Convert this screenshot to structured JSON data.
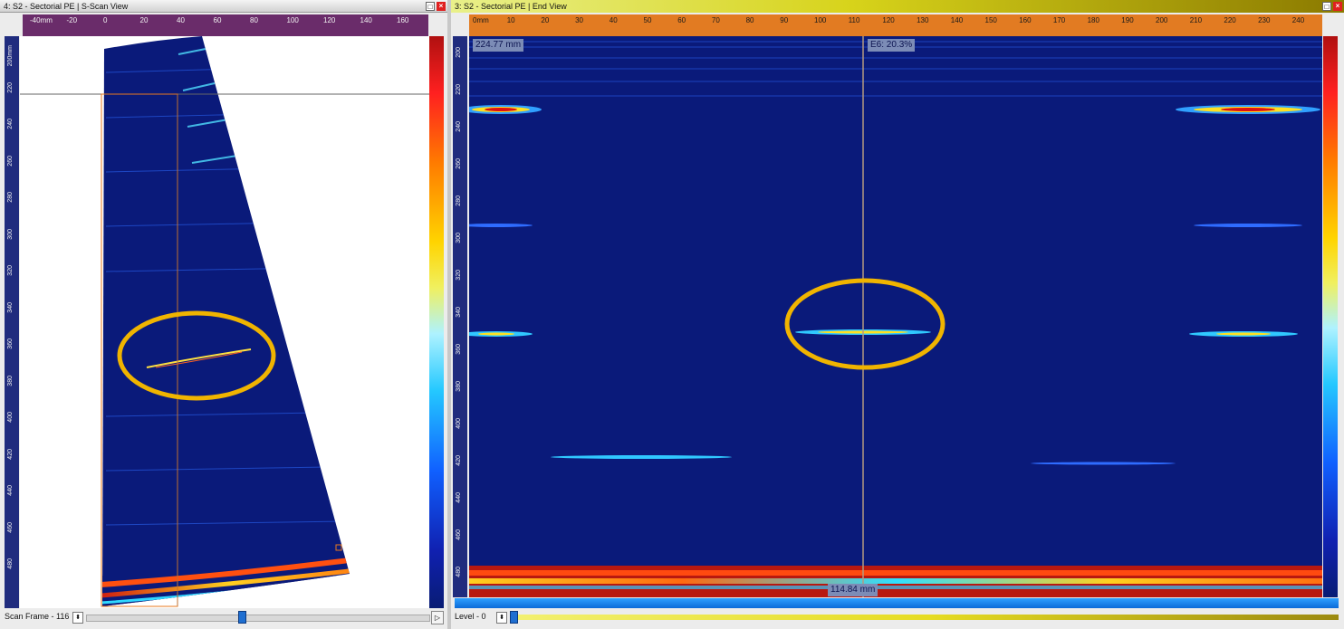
{
  "left_view": {
    "title": "4: S2 - Sectorial PE | S-Scan View",
    "h_ruler_labels": [
      "-40mm",
      "-20",
      "0",
      "20",
      "40",
      "60",
      "80",
      "100",
      "120",
      "140",
      "160"
    ],
    "v_ruler_labels": [
      "200mm",
      "220",
      "240",
      "260",
      "280",
      "300",
      "320",
      "340",
      "360",
      "380",
      "400",
      "420",
      "440",
      "460",
      "480"
    ],
    "scan_frame_label": "Scan Frame - 116",
    "play_icon": "play-icon"
  },
  "right_view": {
    "title": "3: S2 - Sectorial PE | End View",
    "h_ruler_labels": [
      "0mm",
      "10",
      "20",
      "30",
      "40",
      "50",
      "60",
      "70",
      "80",
      "90",
      "100",
      "110",
      "120",
      "130",
      "140",
      "150",
      "160",
      "170",
      "180",
      "190",
      "200",
      "210",
      "220",
      "230",
      "240"
    ],
    "v_ruler_labels": [
      "200",
      "220",
      "240",
      "260",
      "280",
      "300",
      "320",
      "340",
      "360",
      "380",
      "400",
      "420",
      "440",
      "460",
      "480"
    ],
    "depth_readout": "224.77 mm",
    "gate_readout": "E6: 20.3%",
    "cursor_readout": "114.84 mm",
    "level_label": "Level - 0"
  },
  "window_buttons": {
    "minimize": "□",
    "close": "×"
  },
  "colors": {
    "background_blue": "#0a1a7a",
    "highlight_ellipse": "#f0b400",
    "left_ruler": "#6a2c6a",
    "right_ruler": "#e27b22",
    "active_title": "#d7d31a"
  }
}
